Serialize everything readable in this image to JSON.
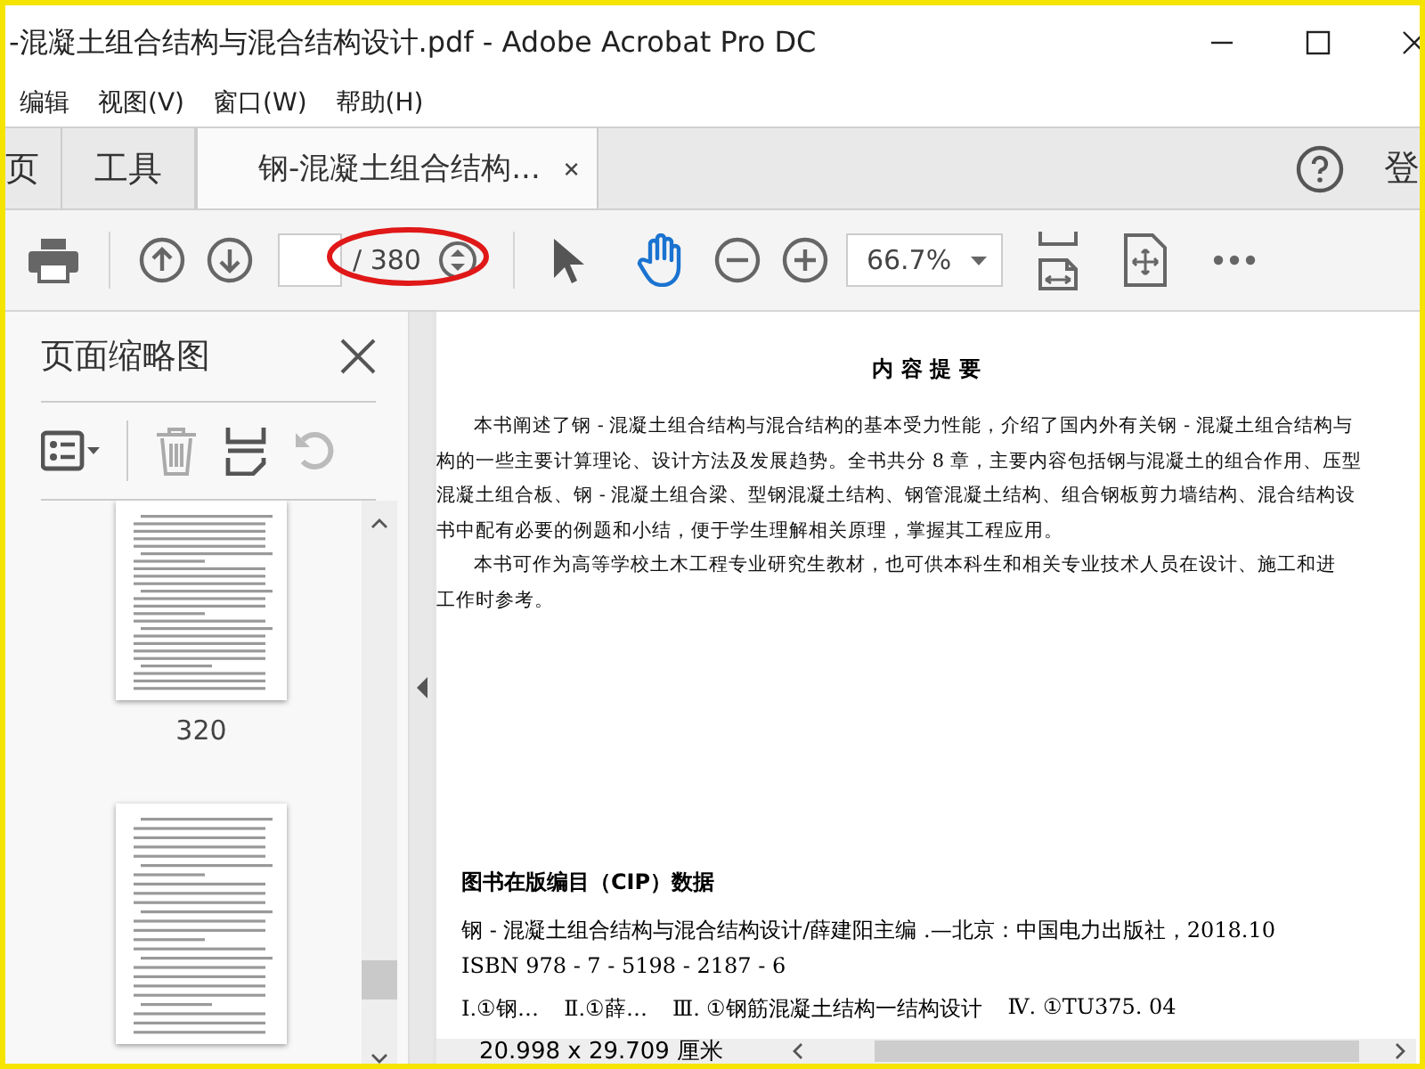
{
  "window": {
    "title": "-混凝土组合结构与混合结构设计.pdf - Adobe Acrobat Pro DC"
  },
  "menu": [
    "编辑",
    "视图(V)",
    "窗口(W)",
    "帮助(H)"
  ],
  "tabs": [
    {
      "label": "页",
      "selected": false
    },
    {
      "label": "工具",
      "selected": false
    },
    {
      "label": "钢-混凝土组合结构...",
      "selected": true
    }
  ],
  "account_label": "登",
  "toolbar": {
    "page_total": "/ 380",
    "zoom": "66.7%",
    "tools": [
      {
        "kind": "select",
        "selected": false
      },
      {
        "kind": "hand",
        "selected": true
      }
    ]
  },
  "thumbnails": {
    "title": "页面缩略图",
    "pages": [
      {
        "kind": "full",
        "label": "320"
      },
      {
        "kind": "partial"
      }
    ]
  },
  "document": {
    "heading": "内 容 提 要",
    "lines": [
      {
        "text": "本书阐述了钢 - 混凝土组合结构与混合结构的基本受力性能，介绍了国内外有关钢 - 混凝土组合结构与",
        "indent": true
      },
      {
        "text": "构的一些主要计算理论、设计方法及发展趋势。全书共分 8 章，主要内容包括钢与混凝土的组合作用、压型",
        "indent": false
      },
      {
        "text": "混凝土组合板、钢 - 混凝土组合梁、型钢混凝土结构、钢管混凝土结构、组合钢板剪力墙结构、混合结构设",
        "indent": false
      },
      {
        "text": "书中配有必要的例题和小结，便于学生理解相关原理，掌握其工程应用。",
        "indent": false
      },
      {
        "text": "本书可作为高等学校土木工程专业研究生教材，也可供本科生和相关专业技术人员在设计、施工和进",
        "indent": true
      },
      {
        "text": "工作时参考。",
        "indent": false
      }
    ],
    "cip_title": "图书在版编目（CIP）数据",
    "cip_lines": [
      "钢 - 混凝土组合结构与混合结构设计/薛建阳主编 .—北京：中国电力出版社，2018.10",
      "ISBN 978 - 7 - 5198 - 2187 - 6"
    ],
    "classification": [
      "Ⅰ.①钢…",
      "Ⅱ.①薛…",
      "Ⅲ. ①钢筋混凝土结构一结构设计",
      "Ⅳ. ①TU375. 04"
    ]
  },
  "status": {
    "page_size": "20.998 x 29.709 厘米"
  }
}
